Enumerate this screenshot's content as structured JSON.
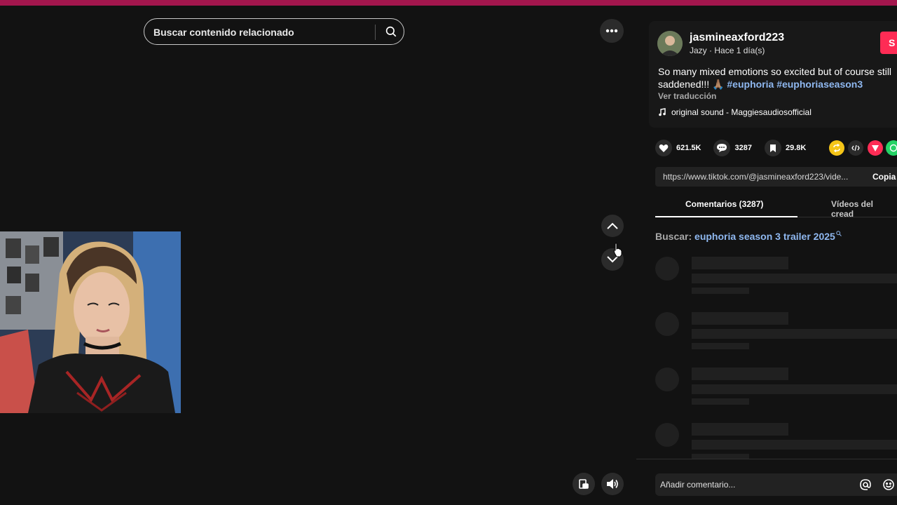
{
  "search": {
    "placeholder": "Buscar contenido relacionado"
  },
  "video": {
    "icons": {
      "more": "more-icon",
      "up": "chevron-up-icon",
      "down": "chevron-down-icon",
      "pip": "picture-in-picture-icon",
      "volume": "volume-icon"
    }
  },
  "post": {
    "username": "jasmineaxford223",
    "display_name": "Jazy",
    "separator": " · ",
    "time_ago": "Hace 1 día(s)",
    "follow_label": "S",
    "caption_text": "So many mixed emotions so excited but of course still saddened!!! 🙏🏽 ",
    "hashtags": [
      "#euphoria",
      "#euphoriaseason3"
    ],
    "translate_label": "Ver traducción",
    "sound": "original sound - Maggiesaudiosofficial"
  },
  "stats": {
    "likes": "621.5K",
    "comments": "3287",
    "saves": "29.8K"
  },
  "share": {
    "link": "https://www.tiktok.com/@jasmineaxford223/vide...",
    "copy_label": "Copia"
  },
  "tabs": [
    {
      "label": "Comentarios (3287)",
      "active": true
    },
    {
      "label": "Vídeos del cread",
      "active": false
    }
  ],
  "related_search": {
    "prefix": "Buscar: ",
    "query": "euphoria season 3 trailer 2025"
  },
  "comment_input": {
    "placeholder": "Añadir comentario..."
  },
  "colors": {
    "accent": "#fe2c55",
    "topbar": "#a3164d",
    "link": "#8fb8f0",
    "background": "#121212"
  }
}
